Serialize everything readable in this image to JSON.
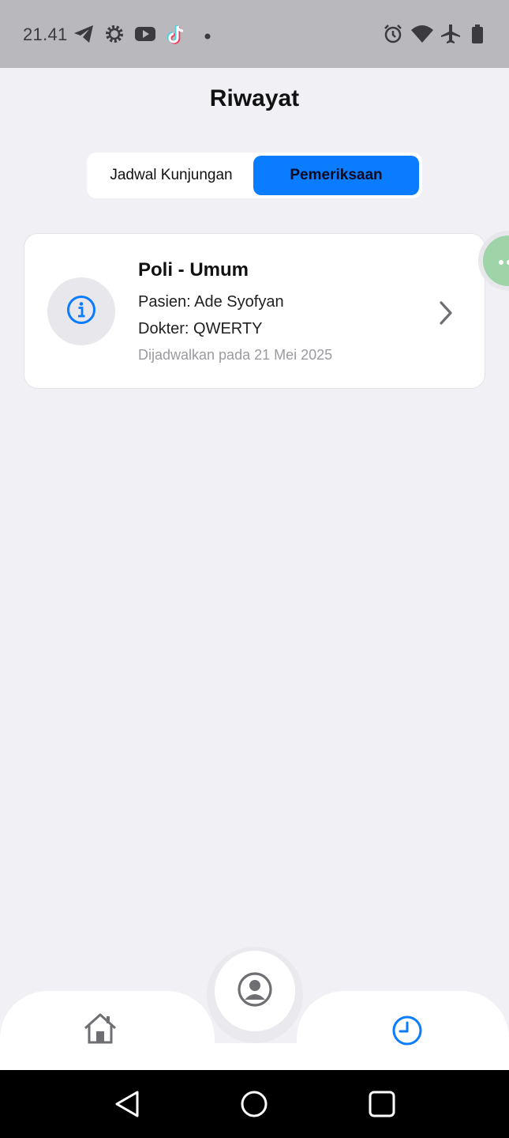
{
  "status_bar": {
    "time": "21.41",
    "left_icons": [
      "telegram-icon",
      "settings-gear-icon",
      "youtube-icon",
      "tiktok-icon",
      "notification-dot-icon"
    ],
    "right_icons": [
      "alarm-icon",
      "wifi-icon",
      "airplane-icon",
      "battery-icon"
    ]
  },
  "header": {
    "title": "Riwayat"
  },
  "tabs": [
    {
      "label": "Jadwal Kunjungan",
      "active": false
    },
    {
      "label": "Pemeriksaan",
      "active": true
    }
  ],
  "records": [
    {
      "icon": "info-icon",
      "title": "Poli - Umum",
      "patient": "Pasien: Ade Syofyan",
      "doctor": "Dokter: QWERTY",
      "scheduled": "Dijadwalkan pada 21 Mei 2025"
    }
  ],
  "bottom_nav": {
    "items": [
      {
        "icon": "home-icon",
        "active": false
      },
      {
        "icon": "profile-icon",
        "active": false
      },
      {
        "icon": "history-clock-icon",
        "active": true
      }
    ]
  },
  "colors": {
    "accent": "#0a7cff",
    "background": "#f1f1f5",
    "status_bar": "#b8b8bd",
    "card": "#ffffff",
    "muted_text": "#9a9aa0",
    "float_bubble": "#9ed4a8"
  }
}
